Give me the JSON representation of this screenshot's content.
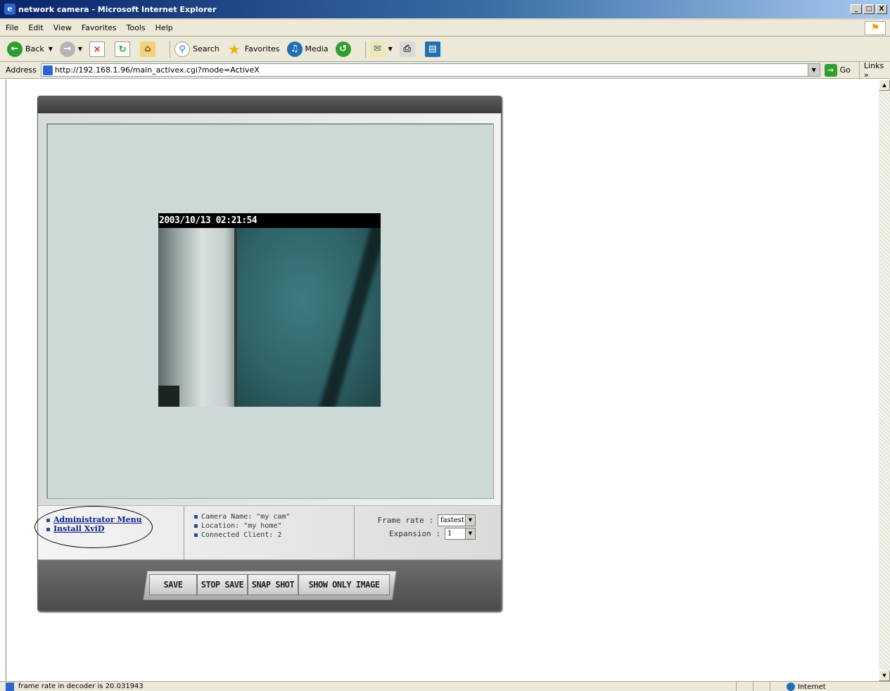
{
  "window": {
    "title": "network camera - Microsoft Internet Explorer",
    "controls": [
      "_",
      "□",
      "X"
    ]
  },
  "menu": [
    "File",
    "Edit",
    "View",
    "Favorites",
    "Tools",
    "Help"
  ],
  "toolbar": {
    "back": "Back",
    "search": "Search",
    "favorites": "Favorites",
    "media": "Media"
  },
  "address": {
    "label": "Address",
    "url": "http://192.168.1.96/main_activex.cgi?mode=ActiveX",
    "go": "Go",
    "links": "Links"
  },
  "camera": {
    "timestamp": "2003/10/13 02:21:54",
    "admin_menu": "Administrator Menu",
    "install_xvid": "Install XviD",
    "info": {
      "name": "Camera Name: \"my cam\"",
      "location": "Location: \"my home\"",
      "clients": "Connected Client: 2"
    },
    "frame_rate_label": "Frame rate :",
    "frame_rate_value": "fastest",
    "expansion_label": "Expansion :",
    "expansion_value": "1",
    "buttons": {
      "save": "SAVE",
      "stop_save": "STOP SAVE",
      "snap_shot": "SNAP SHOT",
      "show_only_image": "SHOW ONLY IMAGE"
    }
  },
  "status": {
    "text": "frame rate in decoder is 20.031943",
    "zone": "Internet"
  }
}
